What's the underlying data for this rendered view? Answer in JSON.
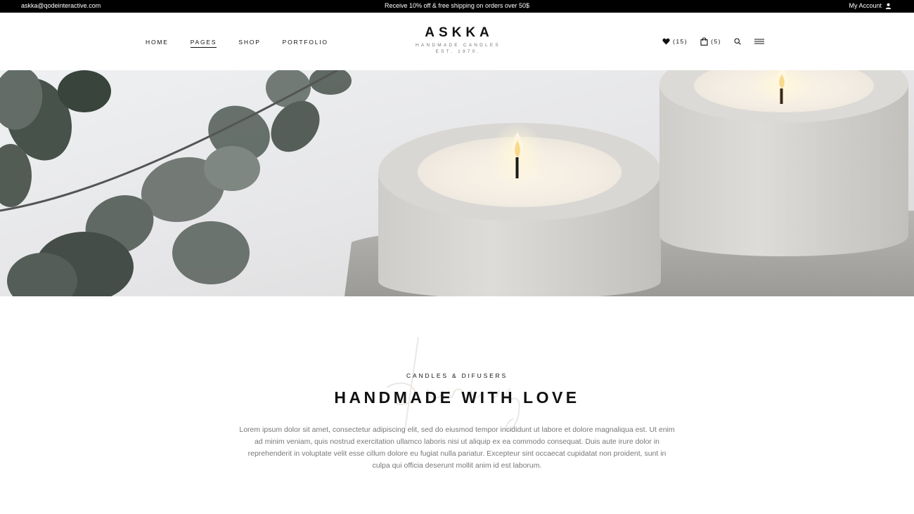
{
  "topbar": {
    "email": "askka@qodeinteractive.com",
    "promo": "Receive 10% off & free shipping on orders over 50$",
    "account_label": "My Account",
    "account_icon": "user-icon"
  },
  "nav": {
    "items": [
      {
        "label": "HOME",
        "active": false
      },
      {
        "label": "PAGES",
        "active": true
      },
      {
        "label": "SHOP",
        "active": false
      },
      {
        "label": "PORTFOLIO",
        "active": false
      }
    ]
  },
  "logo": {
    "name": "ASKKA",
    "tagline": "HANDMADE CANDLES",
    "est": "EST. 1970."
  },
  "header_right": {
    "wishlist_count": "(15)",
    "cart_count": "(5)",
    "icons": [
      "heart-icon",
      "bag-icon",
      "search-icon",
      "menu-icon"
    ]
  },
  "intro": {
    "script_word": "burning",
    "eyebrow": "CANDLES & DIFUSERS",
    "title": "HANDMADE WITH LOVE",
    "body": "Lorem ipsum dolor sit amet, consectetur adipiscing elit, sed do eiusmod tempor incididunt ut labore et dolore magnaliqua est. Ut enim ad minim veniam, quis nostrud exercitation ullamco laboris nisi ut aliquip ex ea commodo consequat. Duis aute irure dolor in reprehenderit in voluptate velit esse cillum dolore eu fugiat nulla pariatur. Excepteur sint occaecat cupidatat non proident, sunt in culpa qui officia deserunt mollit anim id est laborum."
  },
  "colors": {
    "topbar_bg": "#000000",
    "text_dark": "#111111",
    "text_muted": "#777777"
  }
}
